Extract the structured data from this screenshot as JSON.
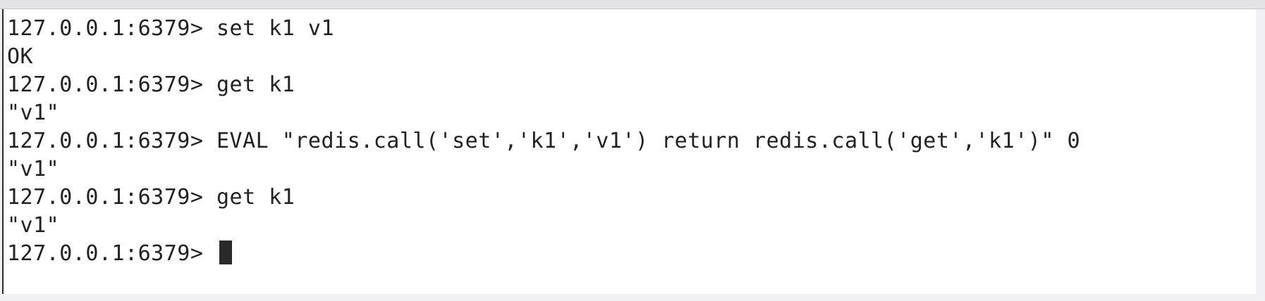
{
  "terminal": {
    "lines": [
      {
        "prompt": "127.0.0.1:6379> ",
        "text": "set k1 v1"
      },
      {
        "prompt": "",
        "text": "OK"
      },
      {
        "prompt": "127.0.0.1:6379> ",
        "text": "get k1"
      },
      {
        "prompt": "",
        "text": "\"v1\""
      },
      {
        "prompt": "127.0.0.1:6379> ",
        "text": "EVAL \"redis.call('set','k1','v1') return redis.call('get','k1')\" 0"
      },
      {
        "prompt": "",
        "text": "\"v1\""
      },
      {
        "prompt": "127.0.0.1:6379> ",
        "text": "get k1"
      },
      {
        "prompt": "",
        "text": "\"v1\""
      },
      {
        "prompt": "127.0.0.1:6379> ",
        "text": ""
      }
    ]
  }
}
